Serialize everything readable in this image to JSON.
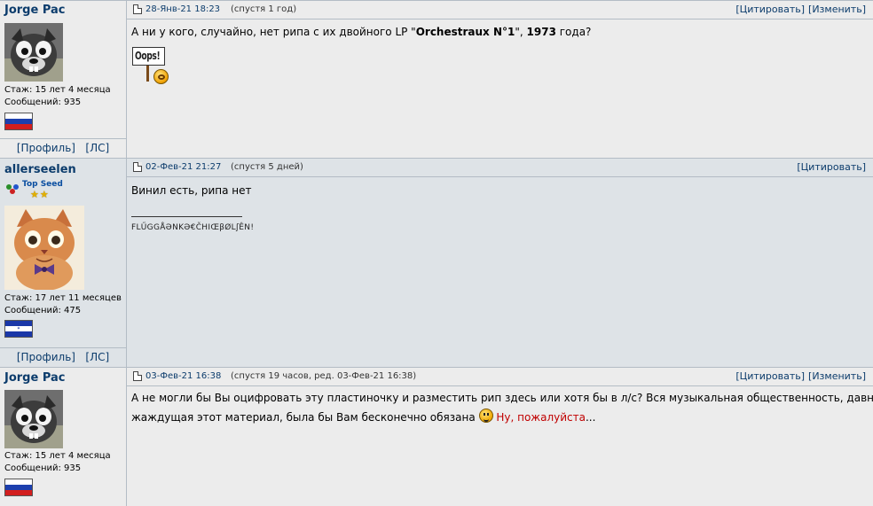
{
  "posts": [
    {
      "author": "Jorge Pac",
      "stats": {
        "tenure": "Стаж: 15 лет 4 месяца",
        "messages": "Сообщений: 935"
      },
      "profile_links": {
        "profile": "[Профиль]",
        "pm": "[ЛС]"
      },
      "date": "28-Янв-21 18:23",
      "later": "(спустя 1 год)",
      "actions": {
        "quote": "[Цитировать]",
        "edit": "[Изменить]"
      },
      "body": {
        "part1": "А ни у кого, случайно, нет рипа с их двойного LP \"",
        "bold1": "Orchestraux N°1",
        "part2": "\", ",
        "bold2": "1973",
        "part3": " года?",
        "sign_text": "Oops!"
      },
      "flag": "russia"
    },
    {
      "author": "allerseelen",
      "rank": "Top Seed",
      "stats": {
        "tenure": "Стаж: 17 лет 11 месяцев",
        "messages": "Сообщений: 475"
      },
      "profile_links": {
        "profile": "[Профиль]",
        "pm": "[ЛС]"
      },
      "date": "02-Фев-21 21:27",
      "later": "(спустя 5 дней)",
      "actions": {
        "quote": "[Цитировать]"
      },
      "body": {
        "text": "Винил есть, рипа нет"
      },
      "signature": "FLŰGGÅƏNKƏ€ČHIŒβØLʃÊN!",
      "flag": "honduras"
    },
    {
      "author": "Jorge Pac",
      "stats": {
        "tenure": "Стаж: 15 лет 4 месяца",
        "messages": "Сообщений: 935"
      },
      "date": "03-Фев-21 16:38",
      "later": "(спустя 19 часов, ред. 03-Фев-21 16:38)",
      "actions": {
        "quote": "[Цитировать]",
        "edit": "[Изменить]"
      },
      "body": {
        "line1": "А не могли бы Вы оцифровать эту пластиночку и разместить рип здесь или хотя бы в л/с? Вся музыкальная общественность, давно",
        "line2": "жаждущая этот материал, была бы Вам бесконечно обязана",
        "plea": "Ну, пожалуйста",
        "ellipsis": "..."
      },
      "flag": "russia"
    }
  ],
  "colors": {
    "accent": "#0c3c6c",
    "border": "#b3bcc5",
    "post_light": "#ececec",
    "post_dark": "#dee3e7",
    "red_text": "#c00000"
  }
}
